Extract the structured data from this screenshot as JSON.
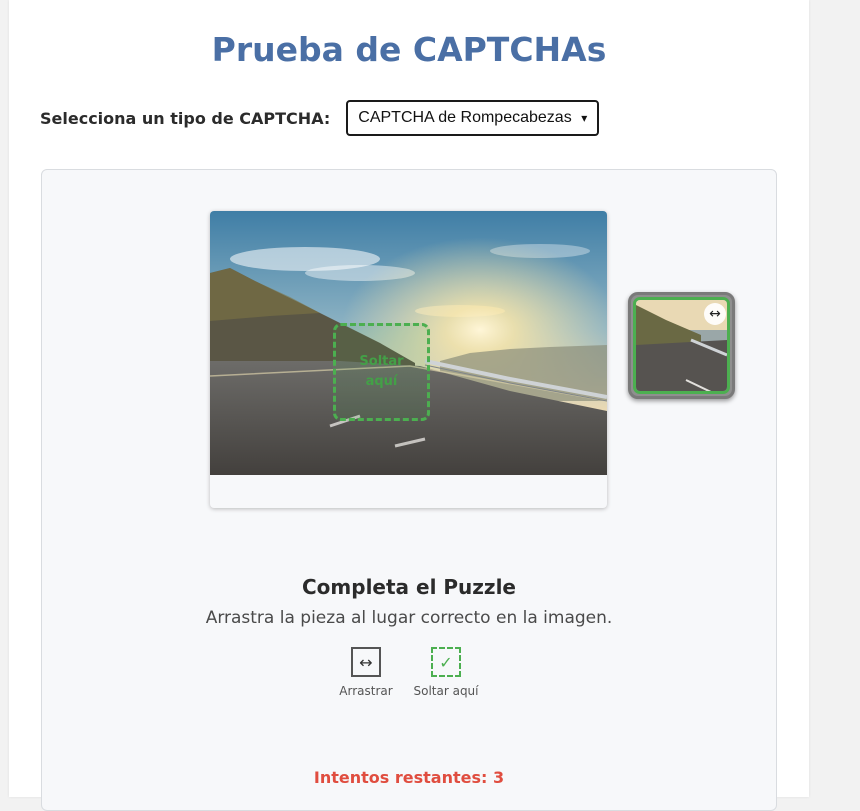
{
  "page": {
    "title": "Prueba de CAPTCHAs"
  },
  "selector": {
    "label": "Selecciona un tipo de CAPTCHA:",
    "selected": "CAPTCHA de Rompecabezas"
  },
  "puzzle": {
    "drop_zone_label": "Soltar aquí",
    "piece_handle_icon": "↔",
    "heading": "Completa el Puzzle",
    "instruction": "Arrastra la pieza al lugar correcto en la imagen.",
    "legend": {
      "drag_icon": "↔",
      "drag_label": "Arrastrar",
      "drop_icon": "✓",
      "drop_label": "Soltar aquí"
    },
    "attempts": "Intentos restantes: 3"
  },
  "colors": {
    "title": "#4a6fa5",
    "accent_green": "#4caf50",
    "attempts_red": "#e04d3f"
  }
}
